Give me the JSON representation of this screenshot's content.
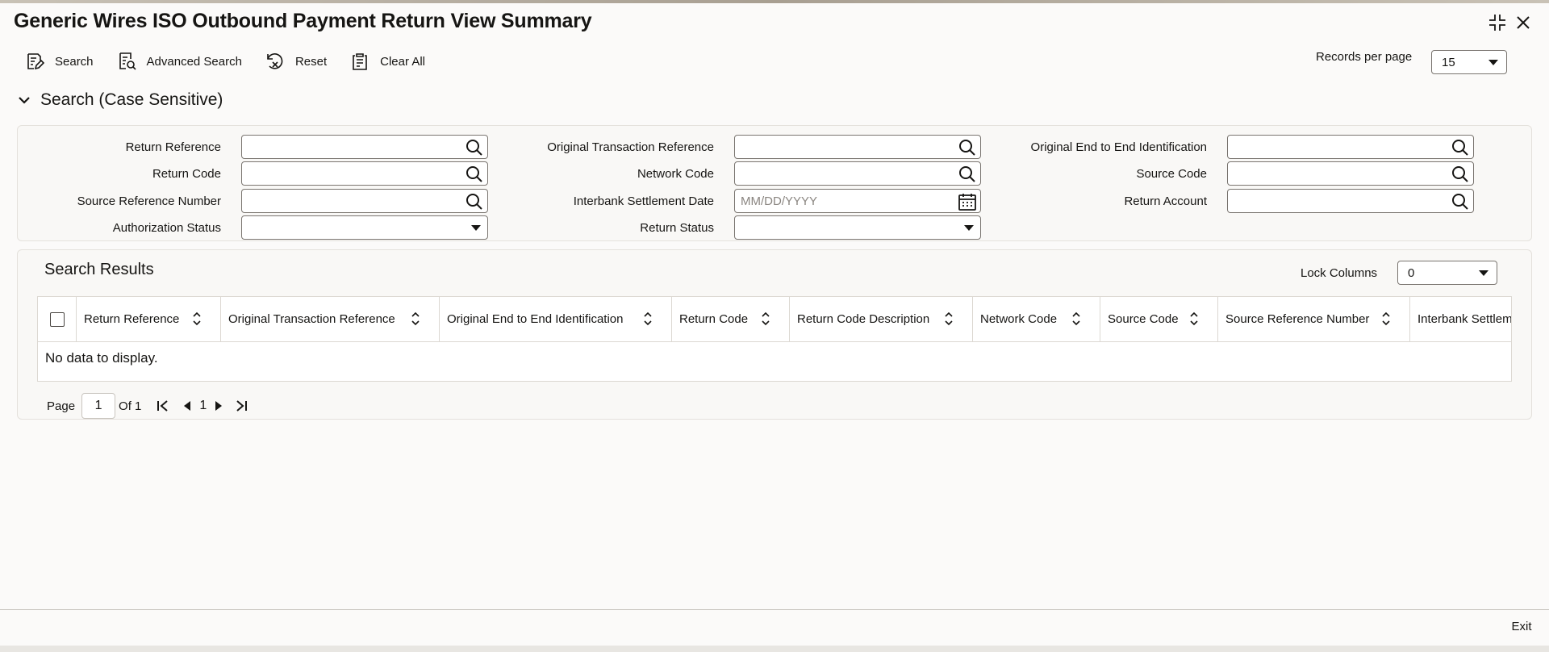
{
  "window": {
    "title": "Generic Wires ISO Outbound Payment Return View Summary"
  },
  "toolbar": {
    "search_label": "Search",
    "advanced_search_label": "Advanced Search",
    "reset_label": "Reset",
    "clear_all_label": "Clear All"
  },
  "records_per_page": {
    "label": "Records per page",
    "value": "15"
  },
  "search_section": {
    "title": "Search (Case Sensitive)",
    "fields": {
      "return_reference": {
        "label": "Return Reference",
        "value": ""
      },
      "original_transaction_reference": {
        "label": "Original Transaction Reference",
        "value": ""
      },
      "original_end_to_end_identification": {
        "label": "Original End to End Identification",
        "value": ""
      },
      "return_code": {
        "label": "Return Code",
        "value": ""
      },
      "network_code": {
        "label": "Network Code",
        "value": ""
      },
      "source_code": {
        "label": "Source Code",
        "value": ""
      },
      "source_reference_number": {
        "label": "Source Reference Number",
        "value": ""
      },
      "interbank_settlement_date": {
        "label": "Interbank Settlement Date",
        "value": "",
        "placeholder": "MM/DD/YYYY"
      },
      "return_account": {
        "label": "Return Account",
        "value": ""
      },
      "authorization_status": {
        "label": "Authorization Status",
        "value": ""
      },
      "return_status": {
        "label": "Return Status",
        "value": ""
      }
    }
  },
  "results": {
    "title": "Search Results",
    "lock_columns_label": "Lock Columns",
    "lock_columns_value": "0",
    "columns": [
      "Return Reference",
      "Original Transaction Reference",
      "Original End to End Identification",
      "Return Code",
      "Return Code Description",
      "Network Code",
      "Source Code",
      "Source Reference Number",
      "Interbank Settlem"
    ],
    "empty_message": "No data to display."
  },
  "pagination": {
    "page_label": "Page",
    "current_page": "1",
    "of_label": "Of 1",
    "page_number_link": "1"
  },
  "footer": {
    "exit_label": "Exit"
  },
  "icons": {
    "toolbar": [
      "search-form-icon",
      "advanced-search-icon",
      "reset-icon",
      "clear-all-icon"
    ],
    "field_lookup": "magnifier-icon",
    "date_picker": "calendar-icon",
    "window": [
      "collapse-icon",
      "close-icon"
    ]
  },
  "colors": {
    "text": "#161513",
    "border": "#7a7570",
    "panel": "#f8f7f5"
  }
}
